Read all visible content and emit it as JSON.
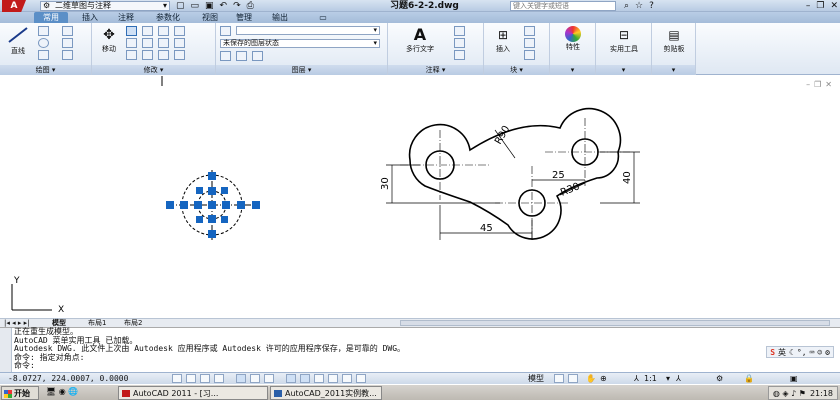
{
  "titlebar": {
    "app_logo": "A",
    "workspace": "二维草图与注释",
    "doc_title": "习题6-2-2.dwg",
    "search_placeholder": "键入关键字或短语",
    "qat_icons": [
      "new-icon",
      "open-icon",
      "save-icon",
      "undo-icon",
      "redo-icon",
      "plot-icon"
    ]
  },
  "tabs": [
    "常用",
    "插入",
    "注释",
    "参数化",
    "视图",
    "管理",
    "输出"
  ],
  "ribbon": {
    "draw": {
      "line_label": "直线",
      "title": "绘图"
    },
    "modify": {
      "move_label": "移动",
      "title": "修改"
    },
    "layers": {
      "state_text": "未保存的图层状态",
      "title": "图层"
    },
    "annotation": {
      "mtext_label": "多行文字",
      "title": "注释"
    },
    "block": {
      "insert_label": "插入",
      "title": "块"
    },
    "properties_label": "特性",
    "utilities_label": "实用工具",
    "clipboard_label": "剪贴板"
  },
  "drawing": {
    "dims": {
      "radius_90": "R90",
      "radius_30": "R30",
      "dim_25": "25",
      "dim_30": "30",
      "dim_40": "40",
      "dim_45": "45"
    },
    "ucs": {
      "x": "X",
      "y": "Y"
    }
  },
  "layout_tabs": [
    "模型",
    "布局1",
    "布局2"
  ],
  "command": {
    "lines": [
      "正在重生成模型。",
      "AutoCAD 菜单实用工具 已加载。",
      "Autodesk DWG.   此文件上次由 Autodesk 应用程序或 Autodesk 许可的应用程序保存，是可靠的 DWG。",
      "命令: 指定对角点:",
      "命令:"
    ],
    "ime": {
      "logo": "S",
      "lang": "英"
    }
  },
  "status": {
    "coords": "-8.0727,  224.0007, 0.0000",
    "model": "模型",
    "scale": "1:1"
  },
  "taskbar": {
    "start": "开始",
    "items": [
      "AutoCAD 2011 - [习...",
      "AutoCAD_2011实例教..."
    ],
    "clock": "21:18"
  }
}
